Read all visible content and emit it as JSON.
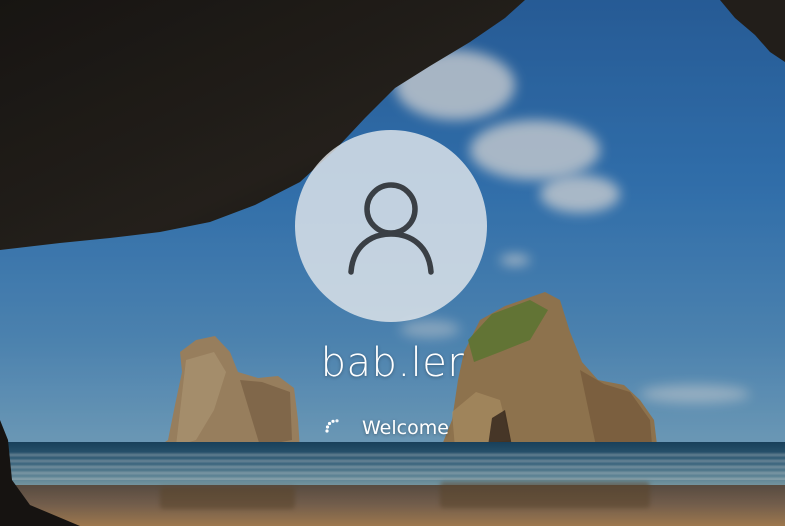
{
  "login": {
    "username": "bab.ler",
    "status_text": "Welcome"
  },
  "icons": {
    "avatar_icon": "user-silhouette-icon",
    "spinner_icon": "loading-spinner-icon"
  },
  "colors": {
    "text": "#ffffff",
    "avatar_tile": "#e2e6ec",
    "avatar_glyph": "#3a3f45"
  }
}
